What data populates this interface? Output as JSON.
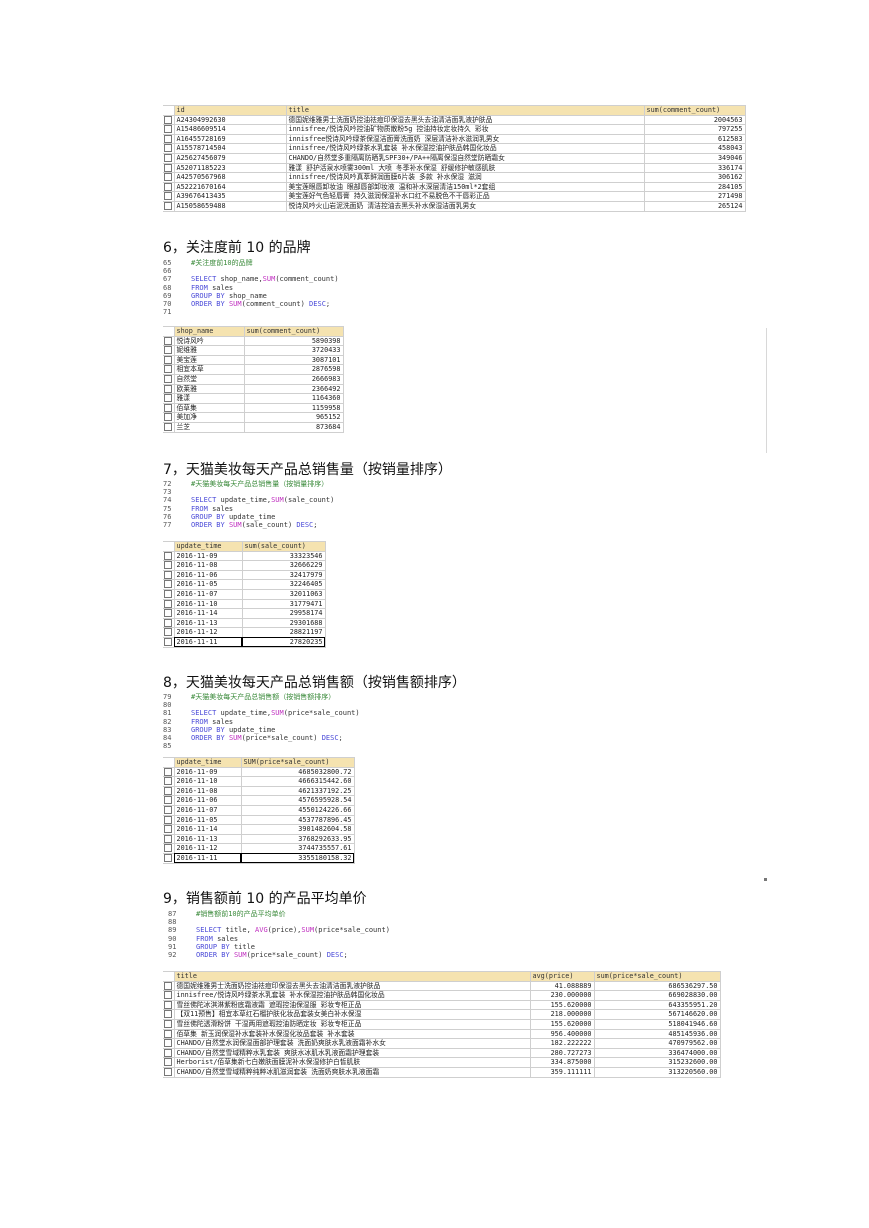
{
  "tables": {
    "top": {
      "headers": [
        "id",
        "title",
        "sum(comment_count)"
      ],
      "rows": [
        [
          "A24304992630",
          "德国妮维雅男士洗面奶控油祛痘印保湿去黑头去油清洁面乳液护肤品",
          "2004563"
        ],
        [
          "A15486609514",
          "innisfree/悦诗风吟控油矿物质散粉5g 控油持妆定妆持久 彩妆",
          "797255"
        ],
        [
          "A16455728169",
          "innisfree悦诗风吟绿茶保湿洁面膏洗面奶 深层清洁补水滋润乳男女",
          "612583"
        ],
        [
          "A15578714504",
          "innisfree/悦诗风吟绿茶水乳套装 补水保湿控油护肤品韩国化妆品",
          "458043"
        ],
        [
          "A25627456079",
          "CHANDO/自然堂多重隔离防晒乳SPF30+/PA++隔离保湿自然堂防晒霜女",
          "349046"
        ],
        [
          "A52071185223",
          "雅漾 舒护活泉水喷雾300ml 大喷 冬季补水保湿 舒缓修护敏感肌肤",
          "336174"
        ],
        [
          "A42570567968",
          "innisfree/悦诗风吟真萃鲜润面膜6片装 多款 补水保湿 滋润",
          "306162"
        ],
        [
          "A52221670164",
          "美宝莲眼唇卸妆油 眼部唇部卸妆液 温和补水深层清洁150ml*2套组",
          "284105"
        ],
        [
          "A39676413435",
          "美宝莲好气色轻唇膏 持久滋润保湿补水口红不易脱色不干唇彩正品",
          "271498"
        ],
        [
          "A15058659488",
          "悦诗风吟火山岩泥洗面奶 清洁控油去黑头补水保湿洁面乳男女",
          "265124"
        ]
      ]
    },
    "t6": {
      "headers": [
        "shop_name",
        "sum(comment_count)"
      ],
      "rows": [
        [
          "悦诗风吟",
          "5890398"
        ],
        [
          "妮维雅",
          "3720433"
        ],
        [
          "美宝莲",
          "3087101"
        ],
        [
          "相宜本草",
          "2876598"
        ],
        [
          "自然堂",
          "2666983"
        ],
        [
          "欧莱雅",
          "2366492"
        ],
        [
          "雅漾",
          "1164360"
        ],
        [
          "佰草集",
          "1159958"
        ],
        [
          "美加净",
          "965152"
        ],
        [
          "兰芝",
          "873684"
        ]
      ]
    },
    "t7": {
      "headers": [
        "update_time",
        "sum(sale_count)"
      ],
      "rows": [
        [
          "2016-11-09",
          "33323546"
        ],
        [
          "2016-11-08",
          "32666229"
        ],
        [
          "2016-11-06",
          "32417979"
        ],
        [
          "2016-11-05",
          "32246405"
        ],
        [
          "2016-11-07",
          "32011063"
        ],
        [
          "2016-11-10",
          "31779471"
        ],
        [
          "2016-11-14",
          "29958174"
        ],
        [
          "2016-11-13",
          "29301688"
        ],
        [
          "2016-11-12",
          "28821197"
        ],
        [
          "2016-11-11",
          "27820235"
        ]
      ]
    },
    "t8": {
      "headers": [
        "update_time",
        "SUM(price*sale_count)"
      ],
      "rows": [
        [
          "2016-11-09",
          "4685032800.72"
        ],
        [
          "2016-11-10",
          "4666315442.60"
        ],
        [
          "2016-11-08",
          "4621337192.25"
        ],
        [
          "2016-11-06",
          "4576595928.54"
        ],
        [
          "2016-11-07",
          "4550124226.66"
        ],
        [
          "2016-11-05",
          "4537787896.45"
        ],
        [
          "2016-11-14",
          "3901482604.58"
        ],
        [
          "2016-11-13",
          "3768292633.95"
        ],
        [
          "2016-11-12",
          "3744735557.61"
        ],
        [
          "2016-11-11",
          "3355180158.32"
        ]
      ]
    },
    "t9": {
      "headers": [
        "title",
        "avg(price)",
        "sum(price*sale_count)"
      ],
      "rows": [
        [
          "德国妮维雅男士洗面奶控油祛痘印保湿去黑头去油清洁面乳液护肤品",
          "41.088889",
          "686536297.50"
        ],
        [
          "innisfree/悦诗风吟绿茶水乳套装 补水保湿控油护肤品韩国化妆品",
          "230.000000",
          "669028830.00"
        ],
        [
          "雪丝佛陀冰淇淋紫粉底霜液霜 遮瑕控油保湿服 彩妆专柜正品",
          "155.620000",
          "643355951.20"
        ],
        [
          "【双11预售】相宜本草红石榴护肤化妆品套装女美白补水保湿",
          "218.000000",
          "567146620.00"
        ],
        [
          "雪丝佛陀透滑粉饼 干湿两用遮瑕控油防晒定妆 彩妆专柜正品",
          "155.620000",
          "518041946.60"
        ],
        [
          "佰草集 新玉润保湿补水套装补水保湿化妆品套装 补水套装",
          "956.400000",
          "485145936.00"
        ],
        [
          "CHANDO/自然堂水润保湿面部护理套装 洗面奶爽肤水乳液面霜补水女",
          "182.222222",
          "470979562.00"
        ],
        [
          "CHANDO/自然堂雪域精粹水乳套装 爽肤水冰肌水乳液面霜护理套装",
          "280.727273",
          "336474000.00"
        ],
        [
          "Herborist/佰草集新七白嫩肤面膜泥补水保湿修护白皙肌肤",
          "334.875000",
          "315232600.00"
        ],
        [
          "CHANDO/自然堂雪域精粹纯粹冰肌滋润套装 洗面奶爽肤水乳液面霜",
          "359.111111",
          "313220560.00"
        ]
      ]
    }
  },
  "sections": {
    "s6": {
      "heading": "6，关注度前 10 的品牌",
      "code": [
        [
          "65",
          "#关注度前10的品牌"
        ],
        [
          "66",
          ""
        ],
        [
          "67",
          "SELECT shop_name,SUM(comment_count)"
        ],
        [
          "68",
          "FROM sales"
        ],
        [
          "69",
          "GROUP BY shop_name"
        ],
        [
          "70",
          "ORDER BY SUM(comment_count) DESC;"
        ],
        [
          "71",
          ""
        ]
      ]
    },
    "s7": {
      "heading": "7，天猫美妆每天产品总销售量（按销量排序）",
      "code": [
        [
          "72",
          "#天猫美妆每天产品总销售量（按销量排序）"
        ],
        [
          "73",
          ""
        ],
        [
          "74",
          "SELECT update_time,SUM(sale_count)"
        ],
        [
          "75",
          "FROM sales"
        ],
        [
          "76",
          "GROUP BY update_time"
        ],
        [
          "77",
          "ORDER BY SUM(sale_count) DESC;"
        ]
      ]
    },
    "s8": {
      "heading": "8，天猫美妆每天产品总销售额（按销售额排序）",
      "code": [
        [
          "79",
          "#天猫美妆每天产品总销售额（按销售额排序）"
        ],
        [
          "80",
          ""
        ],
        [
          "81",
          "SELECT update_time,SUM(price*sale_count)"
        ],
        [
          "82",
          "FROM sales"
        ],
        [
          "83",
          "GROUP BY update_time"
        ],
        [
          "84",
          "ORDER BY SUM(price*sale_count) DESC;"
        ],
        [
          "85",
          ""
        ]
      ]
    },
    "s9": {
      "heading": "9，销售额前 10 的产品平均单价",
      "code": [
        [
          "87",
          "#销售额前10的产品平均单价"
        ],
        [
          "88",
          ""
        ],
        [
          "89",
          "SELECT title, AVG(price),SUM(price*sale_count)"
        ],
        [
          "90",
          "FROM sales"
        ],
        [
          "91",
          "GROUP BY title"
        ],
        [
          "92",
          "ORDER BY SUM(price*sale_count) DESC;"
        ]
      ]
    }
  }
}
